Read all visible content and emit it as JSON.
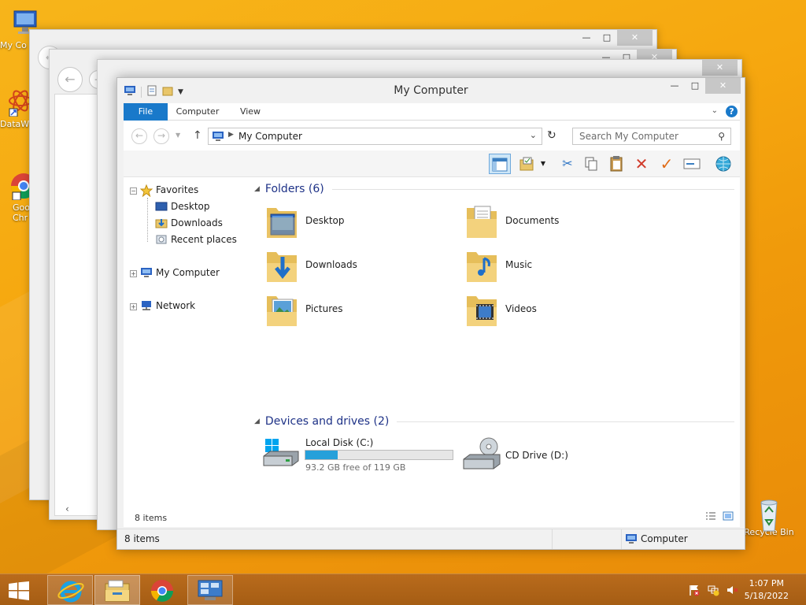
{
  "desktop": {
    "icons": [
      {
        "label": "My Co"
      },
      {
        "label": "DataW"
      },
      {
        "label": "Goo Chr"
      },
      {
        "label": "Recycle Bin"
      }
    ]
  },
  "window": {
    "title": "My Computer",
    "ribbon_tabs": [
      {
        "label": "File"
      },
      {
        "label": "Computer"
      },
      {
        "label": "View"
      }
    ],
    "help_label": "?",
    "address_path": "My Computer",
    "search_placeholder": "Search My Computer",
    "nav": {
      "favorites": "Favorites",
      "favorites_children": [
        "Desktop",
        "Downloads",
        "Recent places"
      ],
      "my_computer": "My Computer",
      "network": "Network"
    },
    "folders_header": "Folders (6)",
    "folders": [
      "Desktop",
      "Documents",
      "Downloads",
      "Music",
      "Pictures",
      "Videos"
    ],
    "drives_header": "Devices and drives (2)",
    "drives": [
      {
        "name": "Local Disk (C:)",
        "free_text": "93.2 GB free of 119 GB",
        "used_fraction": 0.217
      },
      {
        "name": "CD Drive (D:)"
      }
    ],
    "item_count": "8 items",
    "status_items": "8 items",
    "status_location": "Computer"
  },
  "taskbar": {
    "time": "1:07 PM",
    "date": "5/18/2022"
  },
  "colors": {
    "accent": "#1979ca",
    "bar_fill": "#26a0da",
    "desktop": "#f6a70f",
    "taskbar": "#a55d14"
  }
}
